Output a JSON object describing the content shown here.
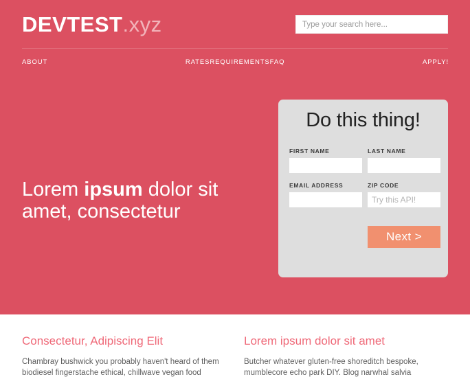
{
  "site": {
    "logo_main": "DEVTEST",
    "logo_tld": ".xyz",
    "brand_red": "#dc5061",
    "accent_salmon": "#f1906f",
    "panel_gray": "#dedede",
    "heading_pink": "#ef6a79"
  },
  "search": {
    "placeholder": "Type your search here...",
    "value": ""
  },
  "nav": {
    "items": [
      {
        "label": "ABOUT"
      },
      {
        "label": "RATES"
      },
      {
        "label": "REQUIREMENTS"
      },
      {
        "label": "FAQ"
      },
      {
        "label": "APPLY!"
      }
    ]
  },
  "hero": {
    "headline_part1": "Lorem ",
    "headline_strong": "ipsum",
    "headline_part2": " dolor sit amet, consectetur"
  },
  "form": {
    "title": "Do this thing!",
    "fields": [
      {
        "label": "FIRST NAME",
        "value": "",
        "placeholder": ""
      },
      {
        "label": "LAST NAME",
        "value": "",
        "placeholder": ""
      },
      {
        "label": "EMAIL ADDRESS",
        "value": "",
        "placeholder": ""
      },
      {
        "label": "ZIP CODE",
        "value": "",
        "placeholder": "Try this API!"
      }
    ],
    "submit_label": "Next >"
  },
  "content": {
    "columns": [
      {
        "heading": "Consectetur, Adipiscing Elit",
        "body": "Chambray bushwick you probably haven't heard of them biodiesel fingerstache ethical, chillwave vegan food"
      },
      {
        "heading": "Lorem ipsum dolor sit amet",
        "body": "Butcher whatever gluten-free shoreditch bespoke, mumblecore echo park DIY. Blog narwhal salvia"
      }
    ]
  }
}
